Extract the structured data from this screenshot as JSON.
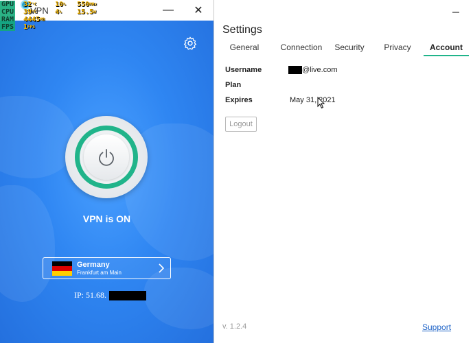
{
  "overlay": {
    "rows": [
      {
        "label": "GPU",
        "v1": "32",
        "u1": "°C",
        "v2": "10",
        "u2": "%",
        "v3": "550",
        "u3": "MHz"
      },
      {
        "label": "CPU",
        "v1": "39",
        "u1": "°C",
        "v2": "4",
        "u2": "%",
        "v3": "15.5",
        "u3": "W"
      },
      {
        "label": "RAM",
        "v1": "4445",
        "u1": "MB",
        "v2": "",
        "u2": "",
        "v3": "",
        "u3": ""
      },
      {
        "label": "FPS",
        "v1": "1",
        "u1": "FPS",
        "v2": "",
        "u2": "",
        "v3": "",
        "u3": ""
      }
    ]
  },
  "vpn": {
    "title": "VPN",
    "minimize_glyph": "—",
    "close_glyph": "✕",
    "status": "VPN is ON",
    "location": {
      "country": "Germany",
      "city": "Frankfurt am Main"
    },
    "ip_label": "IP: 51.68.",
    "colors": {
      "accent": "#20b48a",
      "background": "#2f86f2"
    }
  },
  "settings": {
    "title": "Settings",
    "tabs": [
      {
        "label": "General"
      },
      {
        "label": "Connection"
      },
      {
        "label": "Security"
      },
      {
        "label": "Privacy"
      },
      {
        "label": "Account",
        "active": true
      }
    ],
    "fields": {
      "username_label": "Username",
      "username_value": "@live.com",
      "plan_label": "Plan",
      "plan_value": "",
      "expires_label": "Expires",
      "expires_value": "May 31, 2021"
    },
    "logout_label": "Logout",
    "version": "v. 1.2.4",
    "support_label": "Support"
  }
}
